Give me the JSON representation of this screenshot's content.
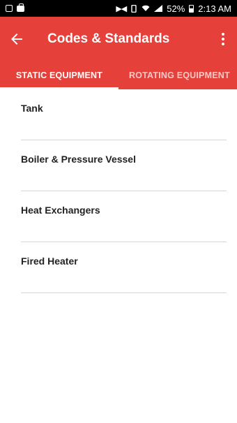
{
  "status_bar": {
    "battery": "52%",
    "time": "2:13 AM"
  },
  "app_bar": {
    "title": "Codes & Standards",
    "background_color": "#e5413a"
  },
  "tabs": [
    {
      "label": "STATIC EQUIPMENT",
      "selected": true
    },
    {
      "label": "ROTATING EQUIPMENT",
      "selected": false
    }
  ],
  "list": {
    "items": [
      {
        "label": "Tank"
      },
      {
        "label": "Boiler & Pressure Vessel"
      },
      {
        "label": "Heat Exchangers"
      },
      {
        "label": "Fired Heater"
      }
    ]
  }
}
